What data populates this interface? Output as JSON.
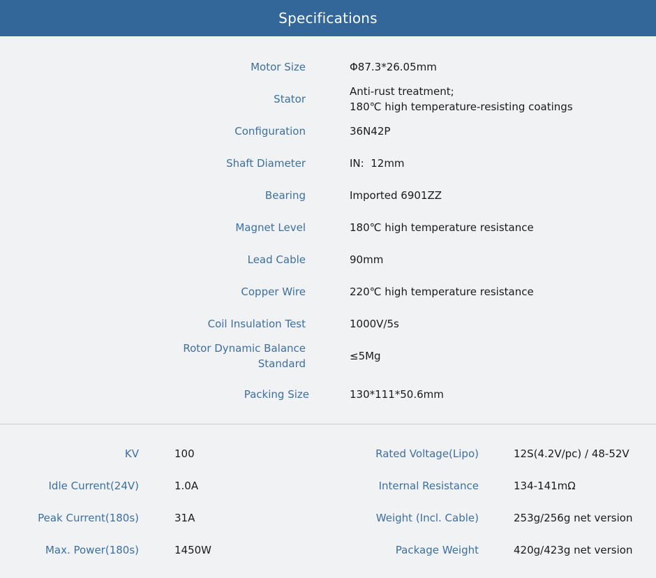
{
  "header": {
    "title": "Specifications"
  },
  "specs": [
    {
      "label": "Motor Size",
      "value": "Φ87.3*26.05mm"
    },
    {
      "label": "Stator",
      "value_line1": "Anti-rust treatment;",
      "value_line2": "180℃ high temperature-resisting coatings"
    },
    {
      "label": "Configuration",
      "value": "36N42P"
    },
    {
      "label": "Shaft Diameter",
      "value": "IN:  12mm"
    },
    {
      "label": "Bearing",
      "value": "Imported 6901ZZ"
    },
    {
      "label": "Magnet Level",
      "value": "180℃ high temperature resistance"
    },
    {
      "label": "Lead Cable",
      "value": "90mm"
    },
    {
      "label": "Copper Wire",
      "value": "220℃ high temperature resistance"
    },
    {
      "label": "Coil Insulation Test",
      "value": "1000V/5s"
    },
    {
      "label_line1": "Rotor Dynamic Balance",
      "label_line2": "Standard",
      "value": "≤5Mg"
    },
    {
      "label": "Packing Size",
      "value": "130*111*50.6mm"
    }
  ],
  "electrical": [
    {
      "left_label": "KV",
      "left_value": "100",
      "right_label": "Rated Voltage(Lipo)",
      "right_value": "12S(4.2V/pc) / 48-52V"
    },
    {
      "left_label": "Idle Current(24V)",
      "left_value": "1.0A",
      "right_label": "Internal Resistance",
      "right_value": "134-141mΩ"
    },
    {
      "left_label": "Peak Current(180s)",
      "left_value": "31A",
      "right_label": "Weight (Incl. Cable)",
      "right_value": "253g/256g net version"
    },
    {
      "left_label": "Max. Power(180s)",
      "left_value": "1450W",
      "right_label": "Package Weight",
      "right_value": "420g/423g net version"
    }
  ]
}
